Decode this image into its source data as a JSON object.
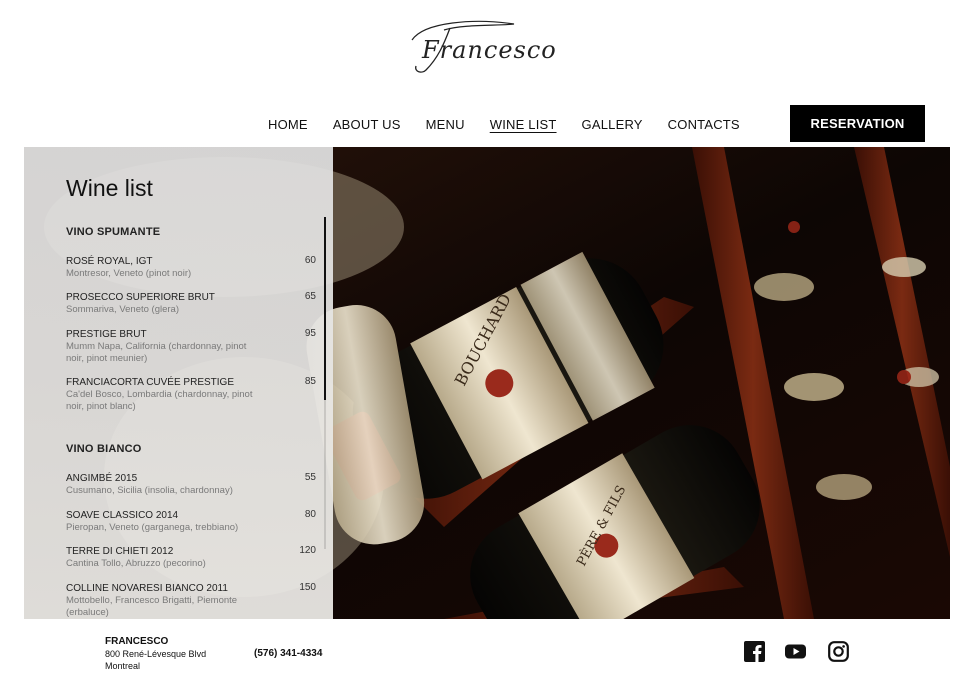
{
  "brand": {
    "logo_text": "Francesco"
  },
  "nav": {
    "items": [
      {
        "label": "HOME"
      },
      {
        "label": "ABOUT US"
      },
      {
        "label": "MENU"
      },
      {
        "label": "WINE LIST"
      },
      {
        "label": "GALLERY"
      },
      {
        "label": "CONTACTS"
      }
    ],
    "active": "WINE LIST",
    "reservation_label": "RESERVATION"
  },
  "wine_list": {
    "title": "Wine list",
    "sections": [
      {
        "heading": "VINO SPUMANTE",
        "wines": [
          {
            "name": "ROSÉ ROYAL, IGT",
            "desc": "Montresor, Veneto (pinot noir)",
            "price": "60"
          },
          {
            "name": "PROSECCO SUPERIORE BRUT",
            "desc": "Sommariva, Veneto (glera)",
            "price": "65"
          },
          {
            "name": "PRESTIGE BRUT",
            "desc": "Mumm Napa, California (chardonnay, pinot noir, pinot meunier)",
            "price": "95"
          },
          {
            "name": "FRANCIACORTA CUVÉE PRESTIGE",
            "desc": "Ca'del Bosco, Lombardia (chardonnay, pinot noir, pinot blanc)",
            "price": "85"
          }
        ]
      },
      {
        "heading": "VINO BIANCO",
        "wines": [
          {
            "name": "ANGIMBÉ 2015",
            "desc": "Cusumano, Sicilia (insolia, chardonnay)",
            "price": "55"
          },
          {
            "name": "SOAVE CLASSICO 2014",
            "desc": "Pieropan, Veneto (garganega, trebbiano)",
            "price": "80"
          },
          {
            "name": "TERRE DI CHIETI 2012",
            "desc": "Cantina Tollo, Abruzzo (pecorino)",
            "price": "120"
          },
          {
            "name": "COLLINE NOVARESI BIANCO 2011",
            "desc": "Mottobello, Francesco Brigatti, Piemonte (erbaluce)",
            "price": "150"
          }
        ]
      }
    ]
  },
  "hero": {
    "label_text_1": "BOUCHARD",
    "label_text_2": "PÈRE & FILS"
  },
  "footer": {
    "name": "FRANCESCO",
    "address_line1": "800 René-Lévesque Blvd",
    "address_line2": "Montreal",
    "phone": "(576) 341-4334",
    "social": [
      "facebook-icon",
      "youtube-icon",
      "instagram-icon"
    ]
  },
  "colors": {
    "button_bg": "#000000",
    "panel_bg": "#e4e3e1",
    "wood": "#5a1c0c"
  }
}
